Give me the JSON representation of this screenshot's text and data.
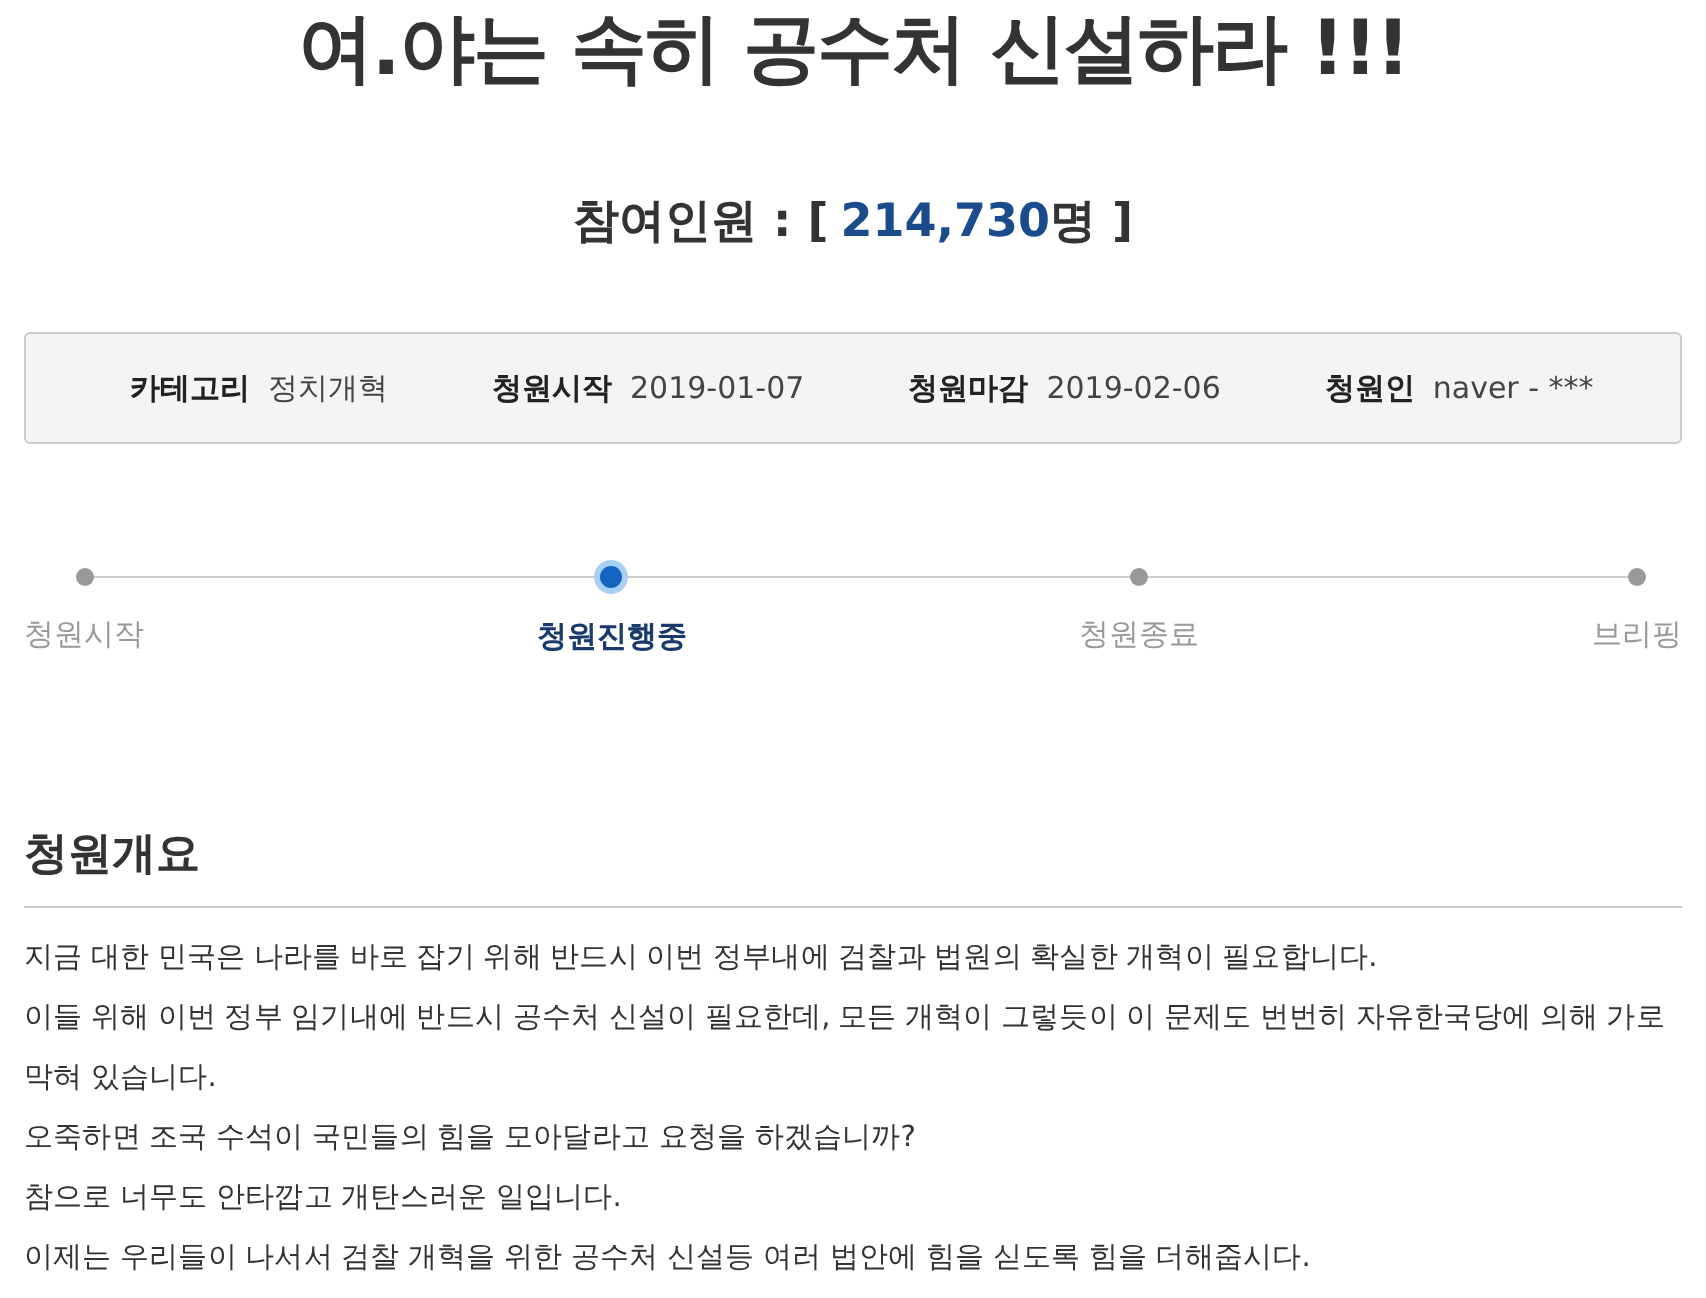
{
  "title": "여.야는 속히 공수처 신설하라 !!!",
  "participants": {
    "label": "참여인원 : [",
    "count": "214,730",
    "unit": "명 ]"
  },
  "info": [
    {
      "label": "카테고리",
      "value": "정치개혁"
    },
    {
      "label": "청원시작",
      "value": "2019-01-07"
    },
    {
      "label": "청원마감",
      "value": "2019-02-06"
    },
    {
      "label": "청원인",
      "value": "naver - ***"
    }
  ],
  "steps": [
    {
      "label": "청원시작",
      "selected": false
    },
    {
      "label": "청원진행중",
      "selected": true
    },
    {
      "label": "청원종료",
      "selected": false
    },
    {
      "label": "브리핑",
      "selected": false
    }
  ],
  "summary": {
    "heading": "청원개요",
    "paragraphs": [
      "지금 대한 민국은 나라를 바로 잡기 위해 반드시 이번 정부내에 검찰과 법원의 확실한 개혁이 필요합니다.",
      "이들 위해 이번 정부 임기내에 반드시 공수처 신설이 필요한데, 모든 개혁이 그렇듯이 이 문제도 번번히 자유한국당에 의해 가로막혀 있습니다.",
      "오죽하면 조국 수석이 국민들의 힘을 모아달라고 요청을 하겠습니까?",
      "참으로 너무도 안타깝고 개탄스러운 일입니다.",
      "이제는 우리들이 나서서 검찰 개혁을 위한 공수처 신설등 여러 법안에 힘을 싣도록 힘을 더해줍시다."
    ]
  }
}
